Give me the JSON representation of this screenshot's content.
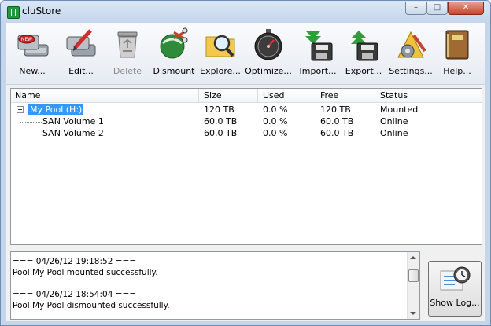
{
  "window": {
    "title": "cluStore"
  },
  "toolbar": {
    "buttons": [
      {
        "label": "New...",
        "icon": "new-disk-icon"
      },
      {
        "label": "Edit...",
        "icon": "edit-icon"
      },
      {
        "label": "Delete",
        "icon": "trash-icon",
        "disabled": true
      },
      {
        "label": "Dismount",
        "icon": "dismount-icon"
      },
      {
        "label": "Explore...",
        "icon": "explore-icon"
      },
      {
        "label": "Optimize...",
        "icon": "stopwatch-icon"
      },
      {
        "label": "Import...",
        "icon": "import-icon"
      },
      {
        "label": "Export...",
        "icon": "export-icon"
      },
      {
        "label": "Settings...",
        "icon": "settings-icon"
      },
      {
        "label": "Help...",
        "icon": "book-icon"
      }
    ]
  },
  "list": {
    "columns": [
      "Name",
      "Size",
      "Used",
      "Free",
      "Status"
    ],
    "rows": [
      {
        "name": "My Pool (H:)",
        "size": "120 TB",
        "used": "0.0 %",
        "free": "120 TB",
        "status": "Mounted"
      },
      {
        "name": "SAN Volume 1",
        "size": "60.0 TB",
        "used": "0.0 %",
        "free": "60.0 TB",
        "status": "Online"
      },
      {
        "name": "SAN Volume 2",
        "size": "60.0 TB",
        "used": "0.0 %",
        "free": "60.0 TB",
        "status": "Online"
      }
    ]
  },
  "log": {
    "lines": [
      "=== 04/26/12 19:18:52 ===",
      "Pool My Pool mounted successfully.",
      "",
      "=== 04/26/12 18:54:04 ===",
      "Pool My Pool dismounted successfully."
    ]
  },
  "showlog": {
    "label": "Show Log..."
  },
  "colors": {
    "accent": "#3399ff",
    "green": "#2e9e3a",
    "red": "#c8432b"
  }
}
